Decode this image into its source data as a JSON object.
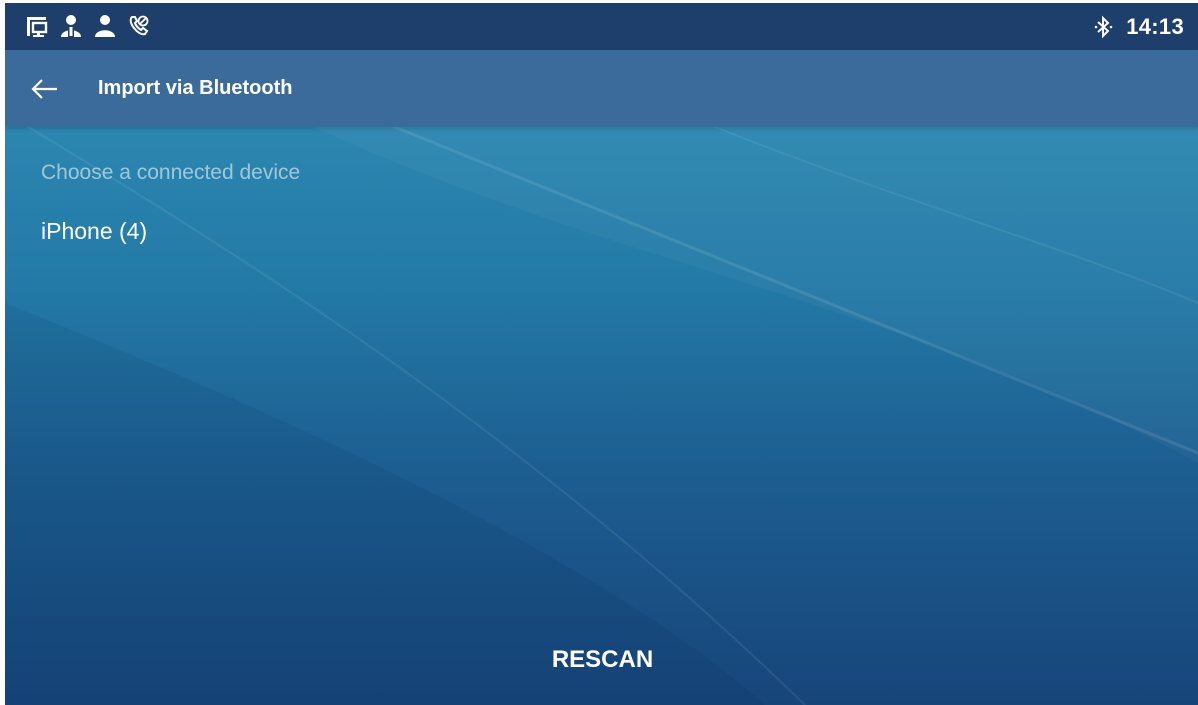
{
  "status_bar": {
    "left_icons": [
      "network-icon",
      "contact-icon",
      "contact-icon",
      "call-forward-icon"
    ],
    "bluetooth_icon": "bluetooth-icon",
    "time": "14:13"
  },
  "app_bar": {
    "back_icon": "back-arrow-icon",
    "title": "Import via Bluetooth"
  },
  "content": {
    "section_label": "Choose a connected device",
    "devices": [
      {
        "label": "iPhone (4)"
      }
    ]
  },
  "footer": {
    "rescan_label": "RESCAN"
  }
}
